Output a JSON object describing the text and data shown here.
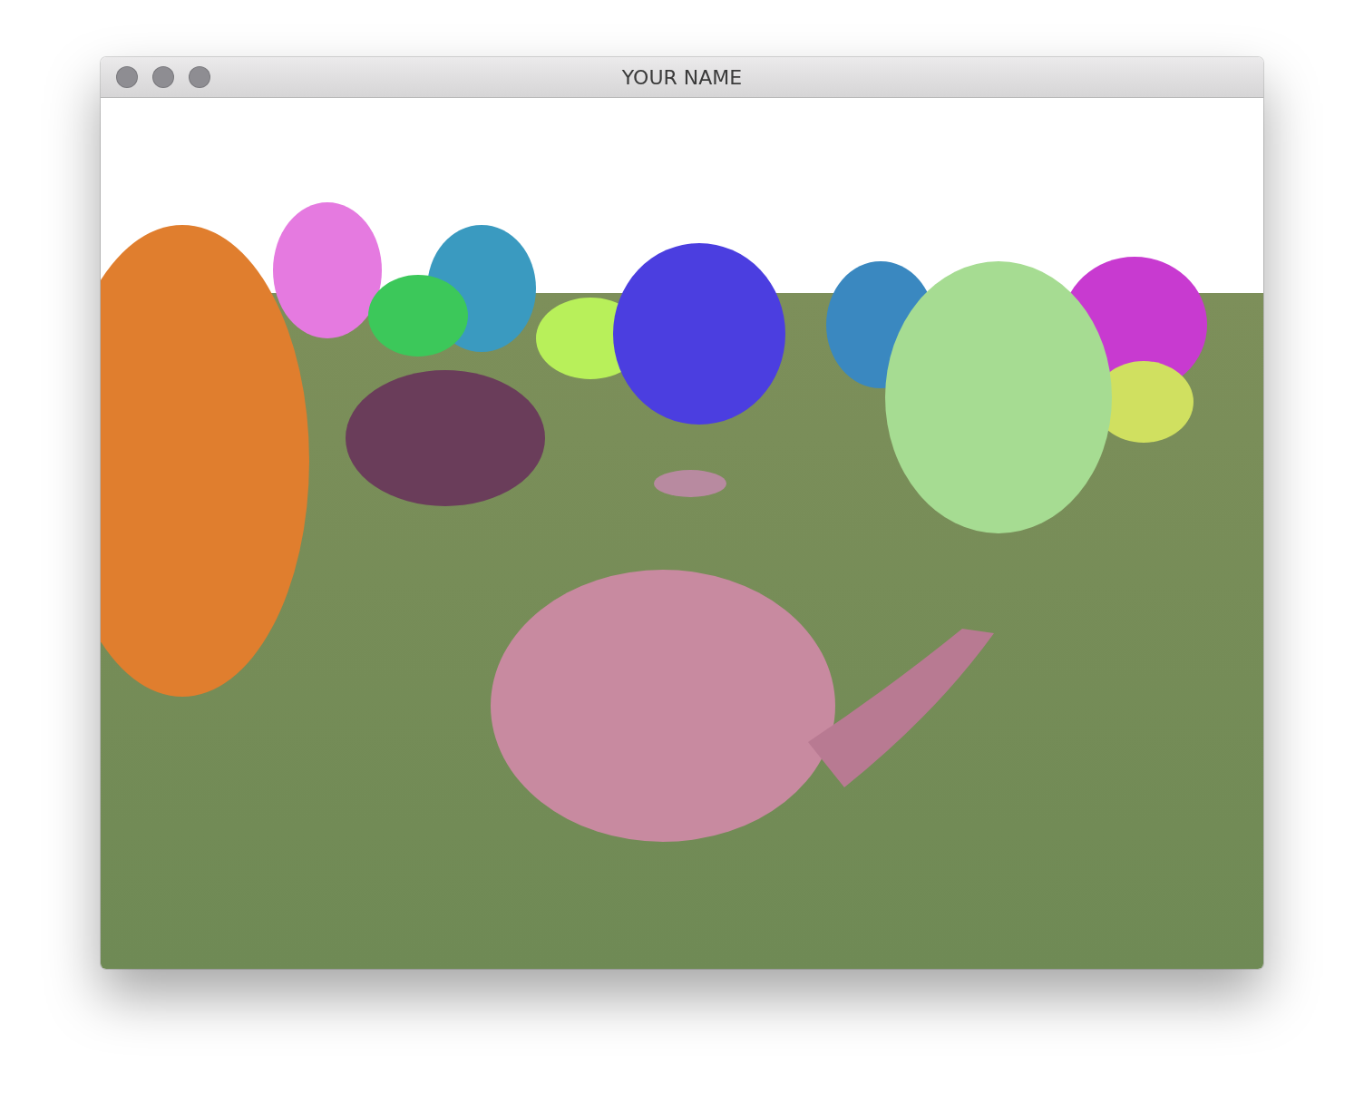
{
  "window": {
    "title": "YOUR NAME",
    "active": false
  }
}
